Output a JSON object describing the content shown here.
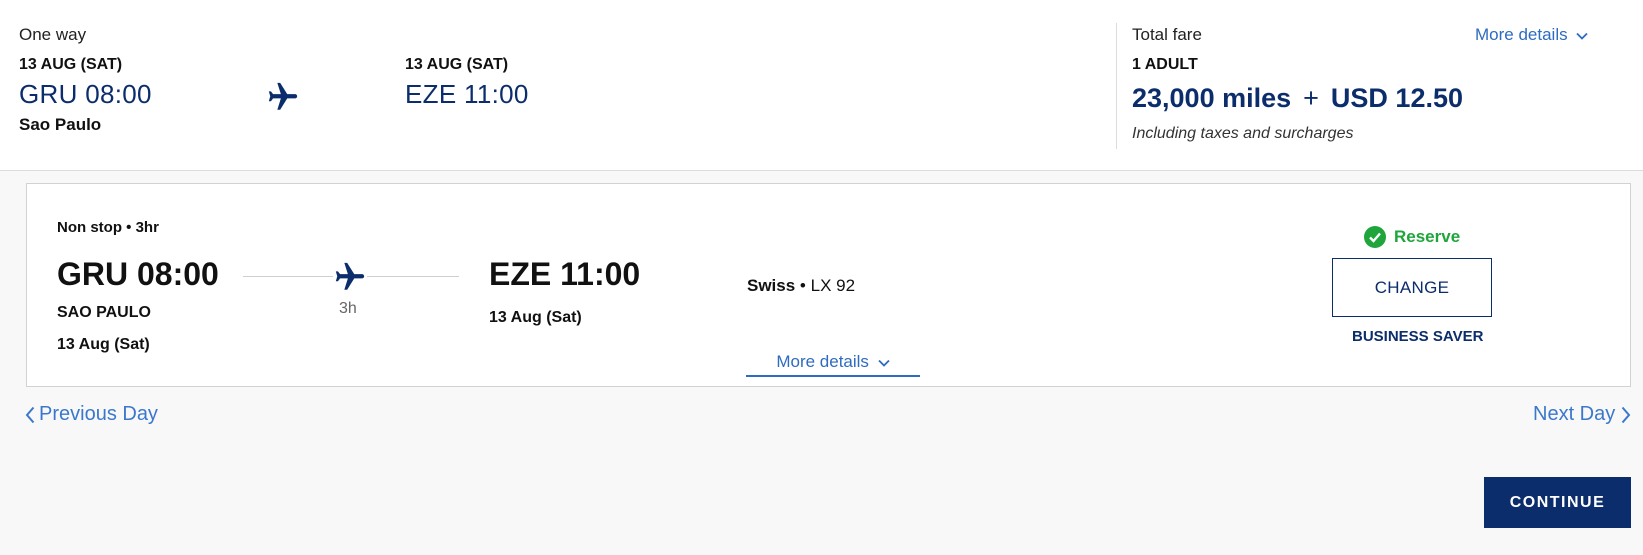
{
  "summary": {
    "trip_type": "One way",
    "departure": {
      "date": "13 AUG (SAT)",
      "code_time": "GRU 08:00",
      "city": "Sao Paulo"
    },
    "arrival": {
      "date": "13 AUG (SAT)",
      "code_time": "EZE 11:00"
    },
    "fare": {
      "title": "Total fare",
      "more_details": "More details",
      "passengers": "1 ADULT",
      "miles": "23,000 miles",
      "plus": "+",
      "cash": "USD 12.50",
      "note": "Including taxes and surcharges"
    }
  },
  "flight_card": {
    "stops": "Non stop • 3hr",
    "departure": {
      "time": "GRU 08:00",
      "city": "SAO PAULO",
      "date": "13 Aug (Sat)"
    },
    "duration": "3h",
    "arrival": {
      "time": "EZE 11:00",
      "date": "13 Aug (Sat)"
    },
    "airline": "Swiss",
    "separator": " • ",
    "flight_number": "LX 92",
    "status": "Reserve",
    "change_label": "CHANGE",
    "fare_class": "BUSINESS SAVER",
    "more_details": "More details"
  },
  "nav": {
    "previous_day": "Previous Day",
    "next_day": "Next Day"
  },
  "continue_label": "CONTINUE",
  "colors": {
    "navy": "#0c2d6b",
    "link_blue": "#2d6cc0",
    "success_green": "#1fa53c"
  },
  "icons": [
    "airplane-icon",
    "check-circle-icon",
    "chevron-down-icon",
    "chevron-left-icon",
    "chevron-right-icon"
  ]
}
